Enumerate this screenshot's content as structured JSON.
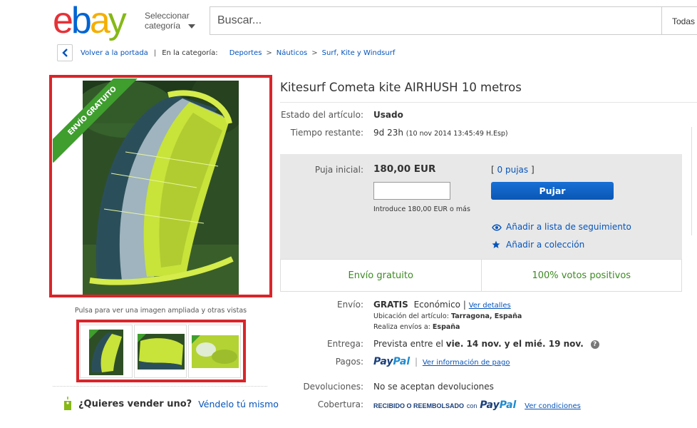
{
  "header": {
    "logo": "ebay",
    "category_selector": "Seleccionar categoría",
    "search_placeholder": "Buscar...",
    "search_scope": "Todas"
  },
  "breadcrumb": {
    "back": "Volver a la portada",
    "in_category": "En la categoría:",
    "items": [
      "Deportes",
      "Náuticos",
      "Surf, Kite y Windsurf"
    ]
  },
  "gallery": {
    "ribbon": "ENVÍO GRATUITO",
    "hint": "Pulsa para ver una imagen ampliada y otras vistas",
    "thumbnail_count": 3
  },
  "sell": {
    "question": "¿Quieres vender uno?",
    "link": "Véndelo tú mismo"
  },
  "item": {
    "title": "Kitesurf Cometa kite AIRHUSH 10 metros",
    "condition_label": "Estado del artículo:",
    "condition_value": "Usado",
    "time_label": "Tiempo restante:",
    "time_value": "9d 23h",
    "time_detail": "(10 nov 2014  13:45:49 H.Esp)"
  },
  "bid": {
    "label": "Puja inicial:",
    "amount": "180,00 EUR",
    "bids_open": "[",
    "bids_link": "0 pujas",
    "bids_close": "]",
    "button": "Pujar",
    "hint": "Introduce 180,00 EUR o más",
    "watchlist": "Añadir a lista de seguimiento",
    "collection": "Añadir a colección"
  },
  "badges": {
    "shipping": "Envío gratuito",
    "feedback": "100% votos positivos"
  },
  "shipping": {
    "label": "Envío:",
    "cost": "GRATIS",
    "service": "Económico",
    "sep": "|",
    "details_link": "Ver detalles",
    "location_label": "Ubicación del artículo:",
    "location_value": "Tarragona, España",
    "ships_to_label": "Realiza envíos a:",
    "ships_to_value": "España"
  },
  "delivery": {
    "label": "Entrega:",
    "prefix": "Prevista entre el",
    "dates": "vie. 14 nov. y el mié. 19 nov.",
    "help": "?"
  },
  "payments": {
    "label": "Pagos:",
    "paypal_1": "Pay",
    "paypal_2": "Pal",
    "info_link": "Ver información de pago"
  },
  "returns": {
    "label": "Devoluciones:",
    "value": "No se aceptan devoluciones"
  },
  "coverage": {
    "label": "Cobertura:",
    "value": "RECIBIDO O REEMBOLSADO",
    "con": "con",
    "paypal_1": "Pay",
    "paypal_2": "Pal",
    "link": "Ver condiciones"
  },
  "colors": {
    "brand_red": "#e53238",
    "brand_blue": "#0064d2",
    "brand_yellow": "#f5af02",
    "brand_green": "#86b817",
    "link": "#0654ba",
    "highlight_frame": "#d9252a",
    "badge_green": "#3c8a22"
  }
}
